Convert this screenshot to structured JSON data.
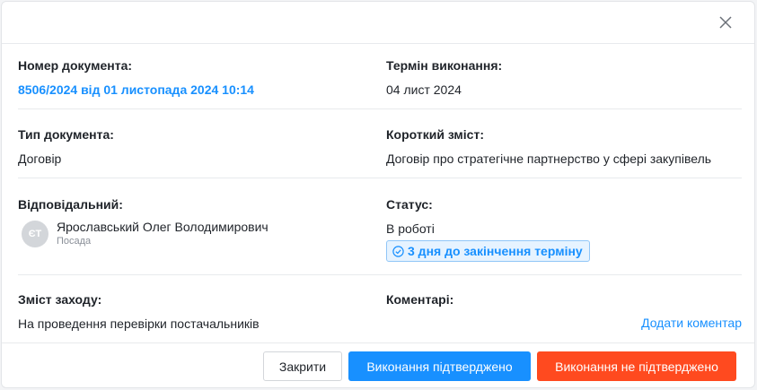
{
  "colors": {
    "accent": "#1890ff",
    "danger": "#ff4a1f",
    "badge_bg": "#e6f3ff"
  },
  "doc_number": {
    "label": "Номер документа:",
    "value": "8506/2024 від 01 листопада 2024 10:14"
  },
  "deadline": {
    "label": "Термін виконання:",
    "value": "04 лист 2024"
  },
  "doc_type": {
    "label": "Тип документа:",
    "value": "Договір"
  },
  "summary": {
    "label": "Короткий зміст:",
    "value": "Договір про стратегічне партнерство у сфері закупівель"
  },
  "responsible": {
    "label": "Відповідальний:",
    "initials": "ЄТ",
    "name": "Ярославський Олег Володимирович",
    "position": "Посада"
  },
  "status": {
    "label": "Статус:",
    "value": "В роботі",
    "badge_icon": "check-circle-icon",
    "badge": "3 дня до закінчення терміну"
  },
  "measure": {
    "label": "Зміст заходу:",
    "value": "На проведення перевірки постачальників"
  },
  "comments": {
    "label": "Коментарі:",
    "add_link": "Додати коментар"
  },
  "footer": {
    "close": "Закрити",
    "confirm": "Виконання підтверджено",
    "reject": "Виконання не підтверджено"
  },
  "icons": {
    "close": "close-icon"
  }
}
